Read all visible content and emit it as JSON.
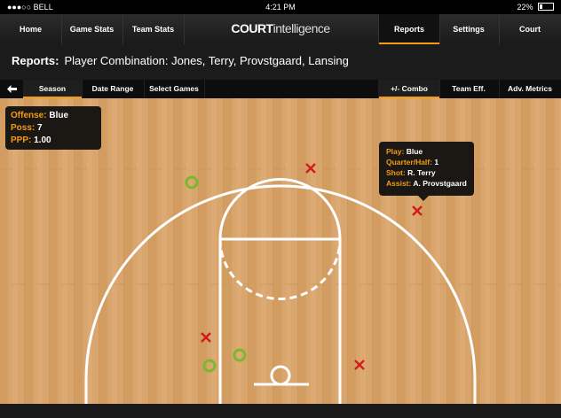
{
  "status_bar": {
    "carrier": "●●●○○ BELL",
    "time": "4:21 PM",
    "battery": "22%"
  },
  "nav": {
    "items": [
      {
        "label": "Home"
      },
      {
        "label": "Game Stats"
      },
      {
        "label": "Team Stats"
      },
      {
        "label": "Reports",
        "active": true
      },
      {
        "label": "Settings"
      },
      {
        "label": "Court"
      }
    ],
    "brand_bold": "COURT",
    "brand_light": "intelligence"
  },
  "report": {
    "label": "Reports:",
    "title": "Player Combination: Jones, Terry, Provstgaard, Lansing"
  },
  "tabs": {
    "left": [
      {
        "label": "Season",
        "active": true
      },
      {
        "label": "Date Range"
      },
      {
        "label": "Select Games"
      }
    ],
    "right": [
      {
        "label": "+/- Combo",
        "active": true
      },
      {
        "label": "Team Eff."
      },
      {
        "label": "Adv. Metrics"
      }
    ]
  },
  "offense_box": {
    "offense_key": "Offense:",
    "offense_val": "Blue",
    "poss_key": "Poss:",
    "poss_val": "7",
    "ppp_key": "PPP:",
    "ppp_val": "1.00"
  },
  "play_tooltip": {
    "play_key": "Play:",
    "play_val": "Blue",
    "quarter_key": "Quarter/Half:",
    "quarter_val": "1",
    "shot_key": "Shot:",
    "shot_val": "R. Terry",
    "assist_key": "Assist:",
    "assist_val": "A. Provstgaard"
  },
  "colors": {
    "accent": "#f39c12",
    "made": "#7cb82f",
    "missed": "#d21d1d",
    "court_wood": "#d9a56b"
  }
}
